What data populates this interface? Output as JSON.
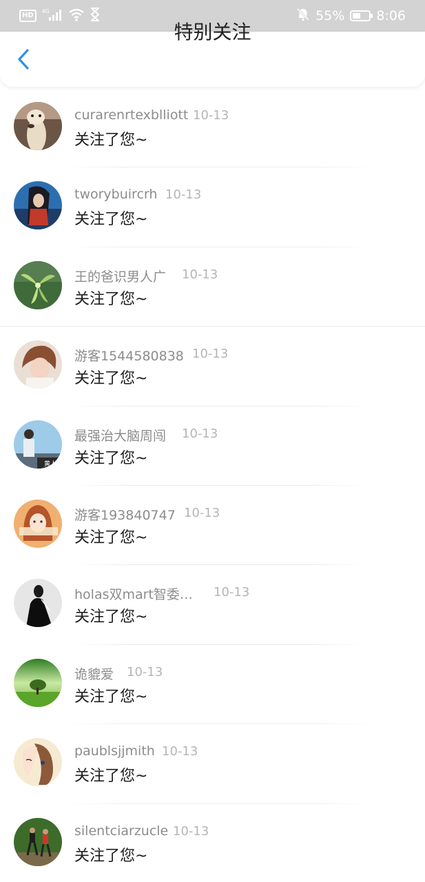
{
  "status_bar": {
    "hd": "HD",
    "network": "4G",
    "battery_percent": "55%",
    "battery_level": 0.55,
    "time": "8:06",
    "icons": [
      "hd-badge",
      "signal-icon",
      "wifi-icon",
      "hourglass-icon",
      "mute-bell-icon",
      "battery-icon"
    ]
  },
  "header": {
    "title": "特别关注",
    "back_icon": "chevron-left-icon",
    "accent_color": "#2f8fe8"
  },
  "items": [
    {
      "username": "curarenrtexblliott",
      "date": "10-13",
      "message": "关注了您~"
    },
    {
      "username": "tworybuircrh",
      "date": "10-13",
      "message": "关注了您~"
    },
    {
      "username": "王的爸识男人广",
      "date": "10-13",
      "message": "关注了您~"
    },
    {
      "username": "游客1544580838",
      "date": "10-13",
      "message": "关注了您~"
    },
    {
      "username": "最强治大脑周闯",
      "date": "10-13",
      "message": "关注了您~"
    },
    {
      "username": "游客193840747",
      "date": "10-13",
      "message": "关注了您~"
    },
    {
      "username": "holas双mart智委…",
      "date": "10-13",
      "message": "关注了您~"
    },
    {
      "username": "诡貔爱",
      "date": "10-13",
      "message": "关注了您~"
    },
    {
      "username": "paublsjjmith",
      "date": "10-13",
      "message": "关注了您~"
    },
    {
      "username": "silentciarzucle",
      "date": "10-13",
      "message": "关注了您~"
    }
  ],
  "avatar_art": "黄人"
}
